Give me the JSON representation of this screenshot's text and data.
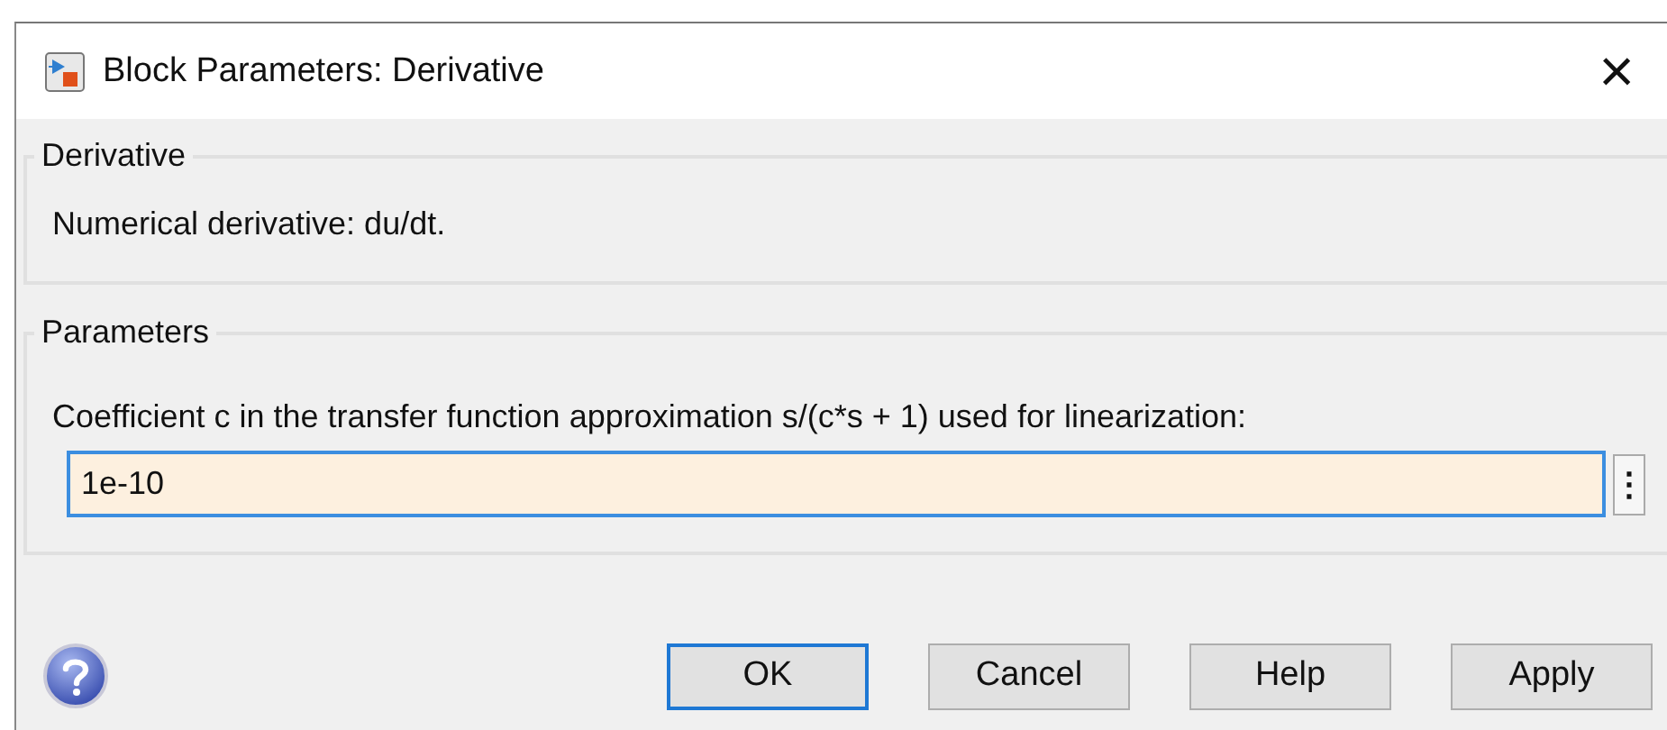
{
  "window": {
    "title": "Block Parameters: Derivative",
    "close": "×"
  },
  "description_group": {
    "legend": "Derivative",
    "text": "Numerical derivative:  du/dt."
  },
  "parameters_group": {
    "legend": "Parameters",
    "field_label": "Coefficient c in the transfer function approximation s/(c*s + 1) used for linearization:",
    "field_value": "1e-10",
    "more": "⋮"
  },
  "buttons": [
    {
      "label": "OK",
      "selected": true
    },
    {
      "label": "Cancel",
      "selected": false
    },
    {
      "label": "Help",
      "selected": false
    },
    {
      "label": "Apply",
      "selected": false
    }
  ]
}
